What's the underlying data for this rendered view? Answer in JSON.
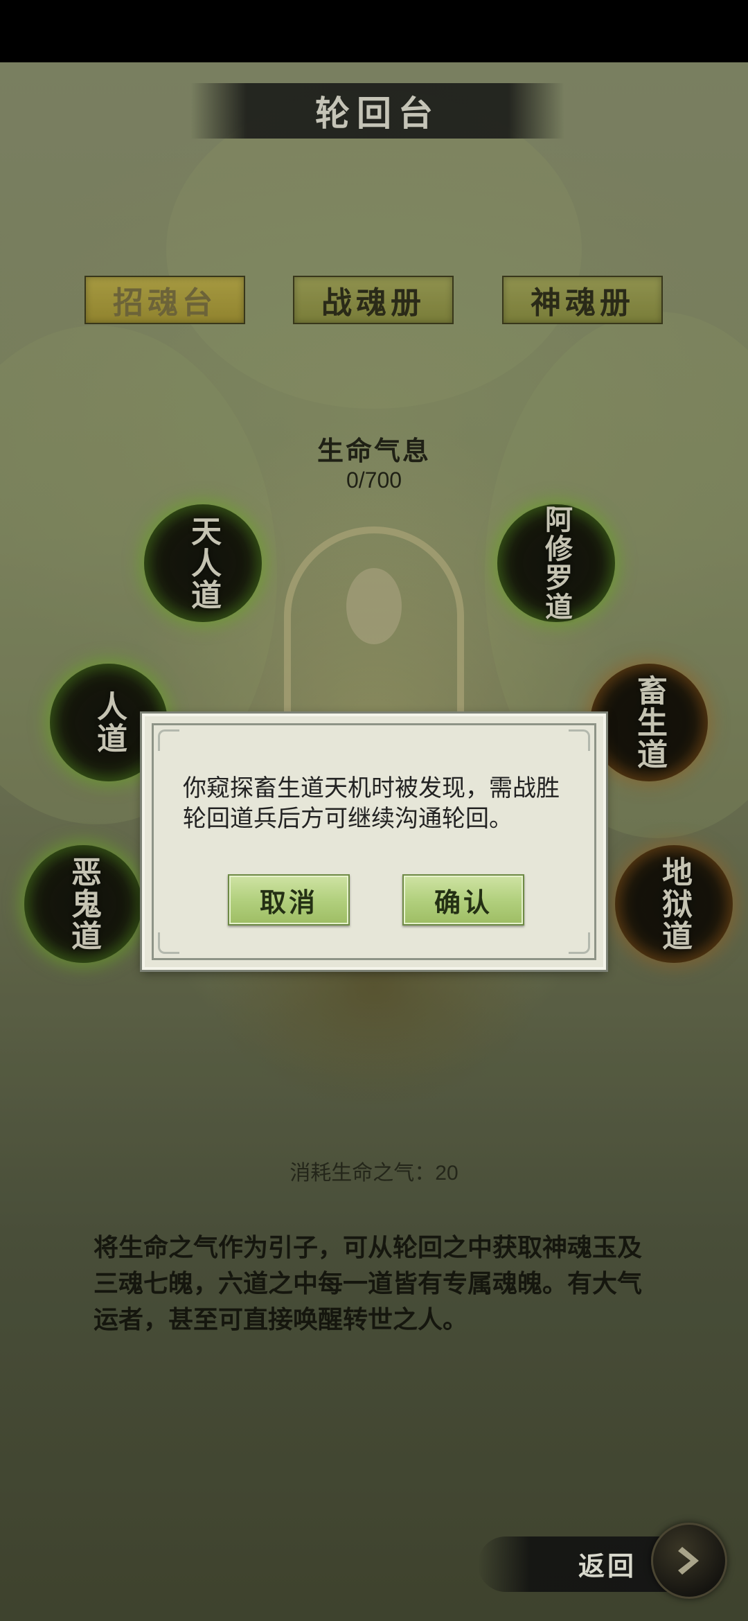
{
  "header": {
    "title": "轮回台"
  },
  "tabs": [
    {
      "label": "招魂台",
      "active": true
    },
    {
      "label": "战魂册",
      "active": false
    },
    {
      "label": "神魂册",
      "active": false
    }
  ],
  "life": {
    "label": "生命气息",
    "value": "0/700"
  },
  "orbs": {
    "tianren": "天人道",
    "asura": "阿修罗道",
    "ren": "人道",
    "chusheng": "畜生道",
    "egui": "恶鬼道",
    "diyu": "地狱道"
  },
  "dialog": {
    "message": "你窥探畜生道天机时被发现，需战胜轮回道兵后方可继续沟通轮回。",
    "cancel_label": "取消",
    "confirm_label": "确认"
  },
  "cost": {
    "text": "消耗生命之气：20"
  },
  "description": "将生命之气作为引子，可从轮回之中获取神魂玉及三魂七魄，六道之中每一道皆有专属魂魄。有大气运者，甚至可直接唤醒转世之人。",
  "footer": {
    "back_label": "返回"
  },
  "colors": {
    "active_tab": "#b8a63e",
    "tab": "#9a9c4c",
    "dialog_button": "#b2d07e",
    "orb_glow": "#78be28"
  }
}
